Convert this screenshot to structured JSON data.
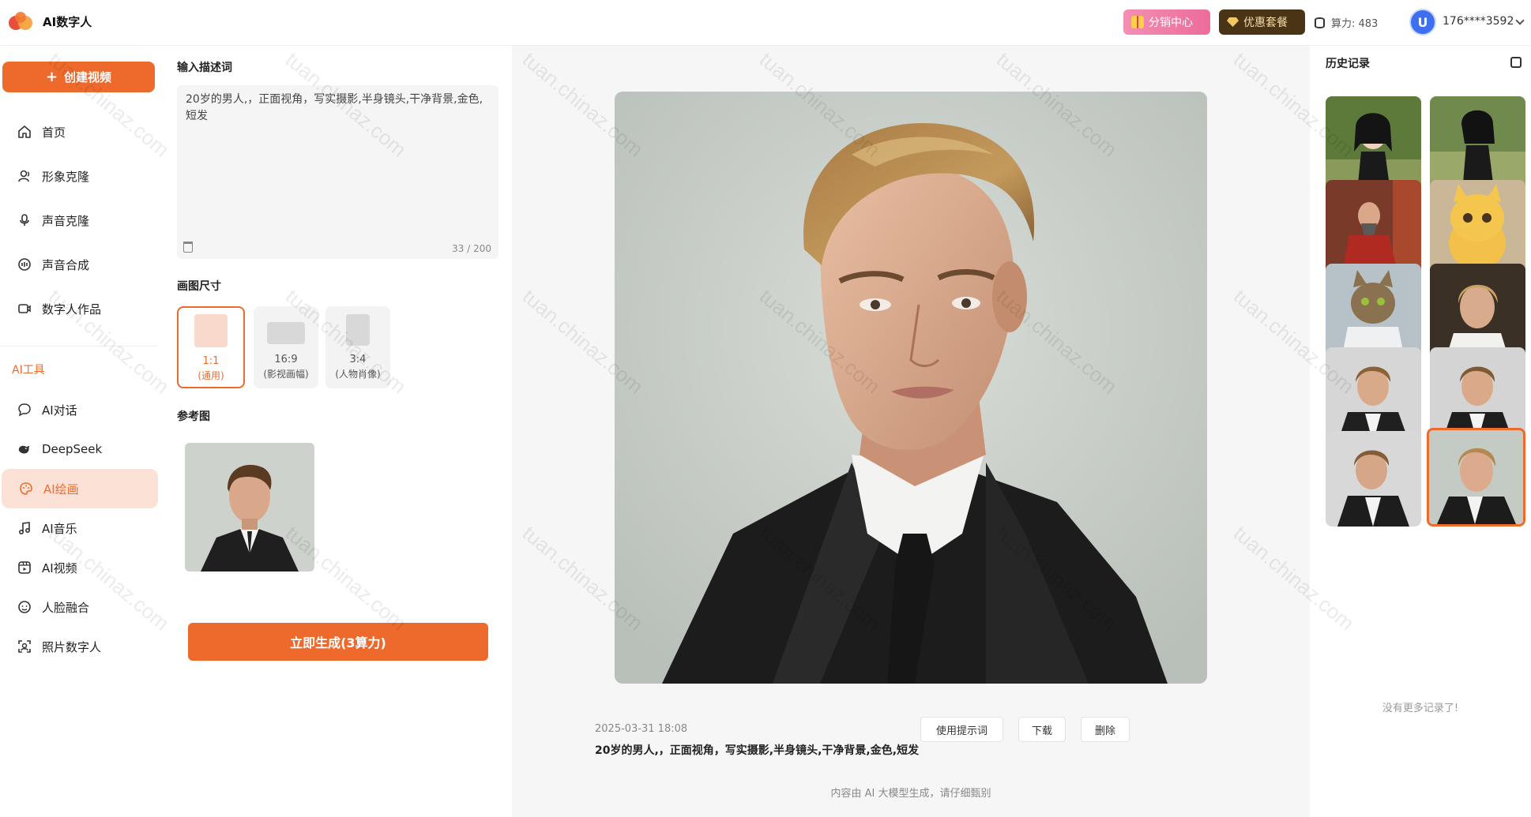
{
  "app": {
    "brand": "AI数字人"
  },
  "topbar": {
    "distribution_label": "分销中心",
    "package_label": "优惠套餐",
    "power_label": "算力: 483",
    "avatar_letter": "U",
    "username": "176****3592"
  },
  "sidebar": {
    "create_label": "创建视频",
    "create_icon": "plus-icon",
    "main_items": [
      {
        "label": "首页",
        "icon": "home-icon"
      },
      {
        "label": "形象克隆",
        "icon": "user-icon"
      },
      {
        "label": "声音克隆",
        "icon": "mic-icon"
      },
      {
        "label": "声音合成",
        "icon": "audio-icon"
      },
      {
        "label": "数字人作品",
        "icon": "video-icon"
      }
    ],
    "tools_title": "AI工具",
    "tool_items": [
      {
        "label": "AI对话",
        "icon": "chat-icon"
      },
      {
        "label": "DeepSeek",
        "icon": "whale-icon"
      },
      {
        "label": "AI绘画",
        "icon": "palette-icon",
        "active": true
      },
      {
        "label": "AI音乐",
        "icon": "music-icon"
      },
      {
        "label": "AI视频",
        "icon": "film-icon"
      },
      {
        "label": "人脸融合",
        "icon": "face-icon"
      },
      {
        "label": "照片数字人",
        "icon": "scan-face-icon"
      }
    ]
  },
  "params": {
    "prompt_title": "输入描述词",
    "prompt_value": "20岁的男人,，正面视角，写实摄影,半身镜头,干净背景,金色,短发",
    "char_count": "33 / 200",
    "size_title": "画图尺寸",
    "sizes": [
      {
        "ratio": "1:1",
        "desc": "(通用)",
        "selected": true
      },
      {
        "ratio": "16:9",
        "desc": "(影视画幅)",
        "selected": false
      },
      {
        "ratio": "3:4",
        "desc": "(人物肖像)",
        "selected": false
      }
    ],
    "reference_title": "参考图",
    "generate_label": "立即生成(3算力)"
  },
  "result": {
    "date": "2025-03-31 18:08",
    "prompt": "20岁的男人,，正面视角，写实摄影,半身镜头,干净背景,金色,短发",
    "use_prompt_label": "使用提示词",
    "download_label": "下载",
    "delete_label": "删除",
    "disclaimer": "内容由 AI 大模型生成，请仔细甄别"
  },
  "history": {
    "title": "历史记录",
    "empty_note": "没有更多记录了!",
    "items": [
      {
        "kind": "anime-girl-forest"
      },
      {
        "kind": "anime-girl-sitting"
      },
      {
        "kind": "old-man-red-robe"
      },
      {
        "kind": "cartoon-cat"
      },
      {
        "kind": "cat-doctor"
      },
      {
        "kind": "blonde-man-white-shirt"
      },
      {
        "kind": "man-suit-1"
      },
      {
        "kind": "man-suit-2"
      },
      {
        "kind": "man-suit-3"
      },
      {
        "kind": "man-suit-4",
        "selected": true
      }
    ]
  },
  "watermark": "tuan.chinaz.com",
  "colors": {
    "accent": "#ee6a2c",
    "accent_light": "#fce2d6",
    "distribution": "#ec6c9b",
    "package": "#4a3416"
  }
}
